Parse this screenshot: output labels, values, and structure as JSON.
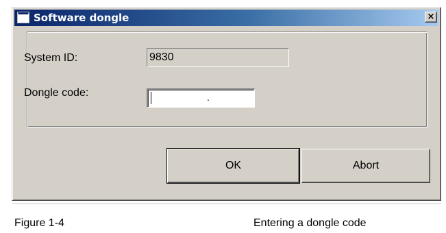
{
  "window": {
    "title": "Software dongle",
    "close_label": "×"
  },
  "form": {
    "system_id_label": "System ID:",
    "system_id_value": "9830",
    "dongle_code_label": "Dongle code:",
    "dongle_code_value": "."
  },
  "buttons": {
    "ok_label": "OK",
    "abort_label": "Abort"
  },
  "caption": {
    "figure_label": "Figure 1-4",
    "figure_text": "Entering a dongle code"
  },
  "colors": {
    "titlebar_start": "#0a246a",
    "titlebar_end": "#a6caf0",
    "dialog_face": "#d4d0c8"
  }
}
